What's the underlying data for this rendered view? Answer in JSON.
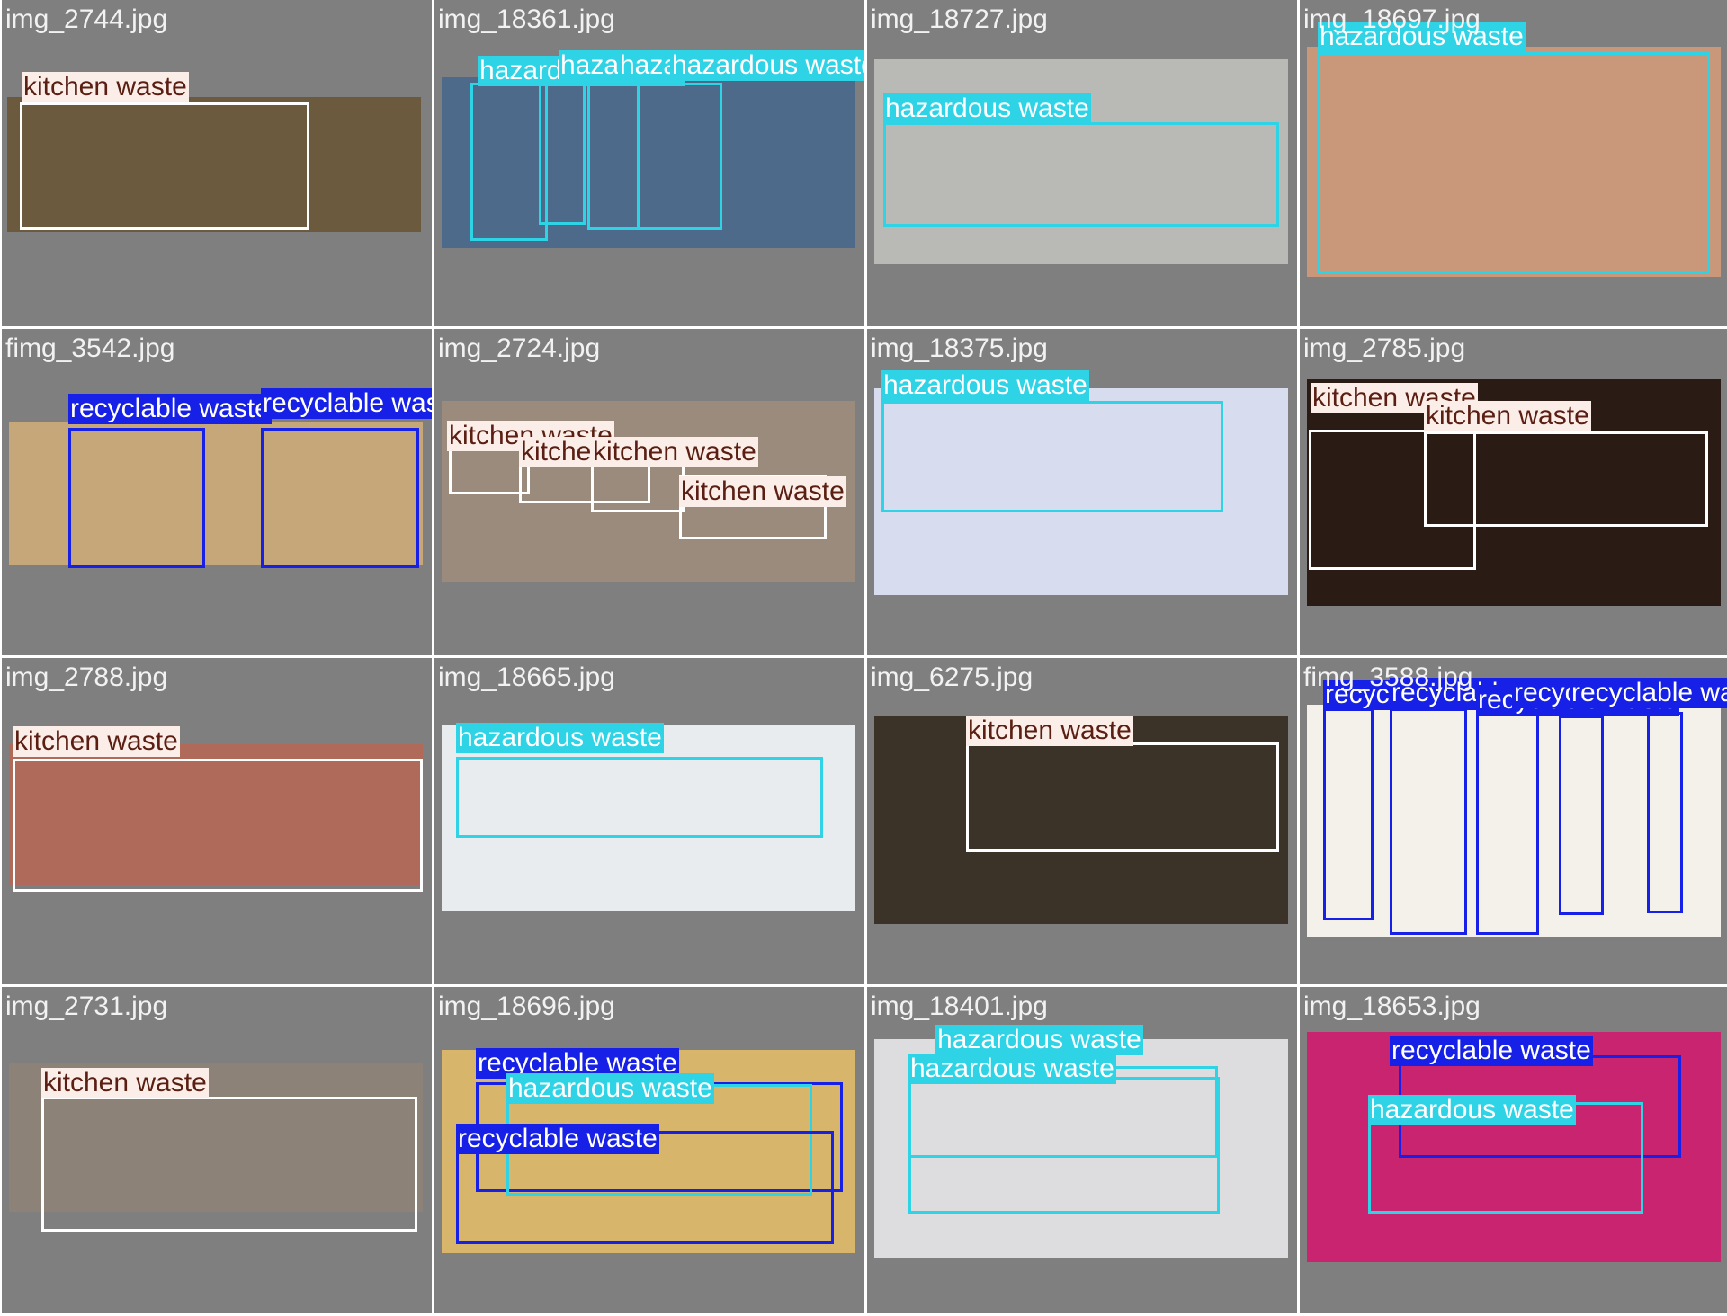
{
  "classes": {
    "kitchen": {
      "name": "kitchen waste",
      "box_color": "#ffffff",
      "label_bg": "#fbeee8",
      "label_fg": "#5a1e12"
    },
    "hazardous": {
      "name": "hazardous waste",
      "box_color": "#2fd3e6",
      "label_bg": "#2fd3e6",
      "label_fg": "#ffffff"
    },
    "recyclable": {
      "name": "recyclable waste",
      "box_color": "#1620e6",
      "label_bg": "#1620e6",
      "label_fg": "#ffffff"
    }
  },
  "tiles": [
    {
      "filename": "img_2744.jpg",
      "photo_color": "#6b5a3e",
      "detections": [
        {
          "cls": "kitchen",
          "label": "kitchen waste"
        }
      ]
    },
    {
      "filename": "img_18361.jpg",
      "photo_color": "#4e6a8a",
      "detections": [
        {
          "cls": "hazardous",
          "label": "hazardous waste"
        },
        {
          "cls": "hazardous",
          "label": "hazardous waste"
        },
        {
          "cls": "hazardous",
          "label": "hazardous waste"
        },
        {
          "cls": "hazardous",
          "label": "hazardous waste"
        }
      ]
    },
    {
      "filename": "img_18727.jpg",
      "photo_color": "#b9b9b5",
      "detections": [
        {
          "cls": "hazardous",
          "label": "hazardous waste"
        }
      ]
    },
    {
      "filename": "img_18697.jpg",
      "photo_color": "#c9977a",
      "detections": [
        {
          "cls": "hazardous",
          "label": "hazardous waste"
        }
      ]
    },
    {
      "filename": "fimg_3542.jpg",
      "photo_color": "#c6a77a",
      "detections": [
        {
          "cls": "recyclable",
          "label": "recyclable waste"
        },
        {
          "cls": "recyclable",
          "label": "recyclable waste"
        }
      ]
    },
    {
      "filename": "img_2724.jpg",
      "photo_color": "#9a8b7c",
      "detections": [
        {
          "cls": "kitchen",
          "label": "kitchen waste"
        },
        {
          "cls": "kitchen",
          "label": "kitchen waste"
        },
        {
          "cls": "kitchen",
          "label": "kitchen waste"
        },
        {
          "cls": "kitchen",
          "label": "kitchen waste"
        }
      ]
    },
    {
      "filename": "img_18375.jpg",
      "photo_color": "#d8dcef",
      "detections": [
        {
          "cls": "hazardous",
          "label": "hazardous waste"
        }
      ]
    },
    {
      "filename": "img_2785.jpg",
      "photo_color": "#2a1b14",
      "detections": [
        {
          "cls": "kitchen",
          "label": "kitchen waste"
        },
        {
          "cls": "kitchen",
          "label": "kitchen waste"
        }
      ]
    },
    {
      "filename": "img_2788.jpg",
      "photo_color": "#b06a5a",
      "detections": [
        {
          "cls": "kitchen",
          "label": "kitchen waste"
        }
      ]
    },
    {
      "filename": "img_18665.jpg",
      "photo_color": "#e9ecef",
      "detections": [
        {
          "cls": "hazardous",
          "label": "hazardous waste"
        }
      ]
    },
    {
      "filename": "img_6275.jpg",
      "photo_color": "#3b3328",
      "detections": [
        {
          "cls": "kitchen",
          "label": "kitchen waste"
        }
      ]
    },
    {
      "filename": "fimg_3588.jpg",
      "photo_color": "#f4f1ea",
      "detections": [
        {
          "cls": "recyclable",
          "label": "recyclable waste"
        },
        {
          "cls": "recyclable",
          "label": "recyclable waste"
        },
        {
          "cls": "recyclable",
          "label": "recyclable waste"
        },
        {
          "cls": "recyclable",
          "label": "recyclable waste"
        },
        {
          "cls": "recyclable",
          "label": "recyclable waste"
        }
      ]
    },
    {
      "filename": "img_2731.jpg",
      "photo_color": "#8d8277",
      "detections": [
        {
          "cls": "kitchen",
          "label": "kitchen waste"
        }
      ]
    },
    {
      "filename": "img_18696.jpg",
      "photo_color": "#d7b56a",
      "detections": [
        {
          "cls": "recyclable",
          "label": "recyclable waste"
        },
        {
          "cls": "hazardous",
          "label": "hazardous waste"
        },
        {
          "cls": "recyclable",
          "label": "recyclable waste"
        }
      ]
    },
    {
      "filename": "img_18401.jpg",
      "photo_color": "#dddde0",
      "detections": [
        {
          "cls": "hazardous",
          "label": "hazardous waste"
        },
        {
          "cls": "hazardous",
          "label": "hazardous waste"
        }
      ]
    },
    {
      "filename": "img_18653.jpg",
      "photo_color": "#c8246f",
      "detections": [
        {
          "cls": "recyclable",
          "label": "recyclable waste"
        },
        {
          "cls": "hazardous",
          "label": "hazardous waste"
        }
      ]
    }
  ]
}
